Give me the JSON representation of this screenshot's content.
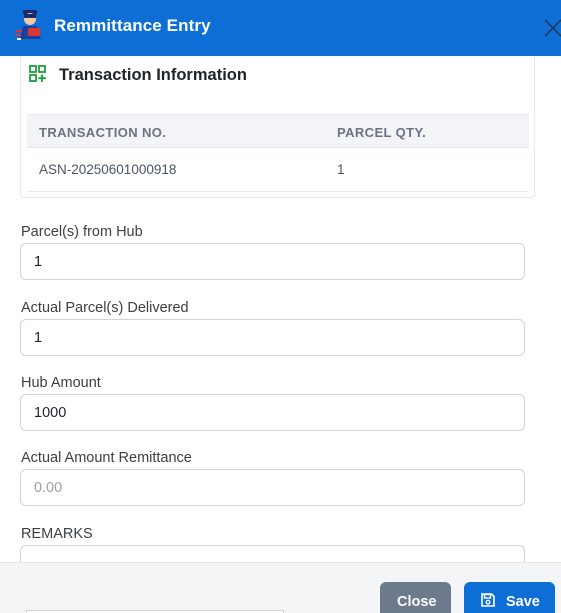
{
  "header": {
    "title": "Remmittance Entry"
  },
  "transaction_card": {
    "title": "Transaction Information",
    "columns": [
      "TRANSACTION NO.",
      "PARCEL QTY."
    ],
    "rows": [
      [
        "ASN-20250601000918",
        "1"
      ]
    ]
  },
  "form": {
    "parcels_from_hub": {
      "label": "Parcel(s) from Hub",
      "value": "1"
    },
    "actual_parcels_delivered": {
      "label": "Actual Parcel(s) Delivered",
      "value": "1"
    },
    "hub_amount": {
      "label": "Hub Amount",
      "value": "1000"
    },
    "actual_amount_remittance": {
      "label": "Actual Amount Remittance",
      "value": "",
      "placeholder": "0.00"
    },
    "remarks": {
      "label": "REMARKS",
      "value": ""
    }
  },
  "footer": {
    "close_label": "Close",
    "save_label": "Save"
  },
  "colors": {
    "primary": "#0d6fd6",
    "secondary": "#6c7a8c",
    "accent_green": "#1e9e3a"
  }
}
